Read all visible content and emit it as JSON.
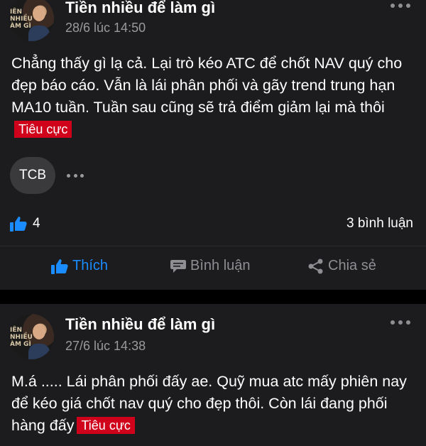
{
  "posts": [
    {
      "author": "Tiền nhiều để làm gì",
      "avatar_text": "IÊN\nNHIỀU\nÀM GÌ",
      "time": "28/6 lúc 14:50",
      "content": "Chẳng thấy gì lạ cả. Lại trò kéo ATC để chốt NAV quý cho đẹp báo cáo. Vẫn là lái phân phối và gãy trend trung hạn MA10 tuần. Tuần sau cũng sẽ trả điểm giảm lại mà thôi",
      "sentiment": "Tiêu cực",
      "ticker": "TCB",
      "likes": "4",
      "comments": "3 bình luận",
      "actions": {
        "like": "Thích",
        "comment": "Bình luận",
        "share": "Chia sẻ"
      }
    },
    {
      "author": "Tiền nhiều để làm gì",
      "avatar_text": "IÊN\nNHIỀU\nÀM GÌ",
      "time": "27/6 lúc 14:38",
      "content": "M.á ..... Lái phân phối đấy ae. Quỹ mua atc mấy phiên nay để kéo giá chốt nav quý cho đẹp thôi. Còn lái đang phối hàng đấy",
      "sentiment": "Tiêu cực"
    }
  ],
  "colors": {
    "card_bg": "#1c1c1e",
    "page_bg": "#000000",
    "accent_blue": "#1a8cff",
    "negative_tag": "#d0021b",
    "muted": "#8e8e93"
  },
  "icons": [
    "thumbs-up-icon",
    "comment-icon",
    "share-icon",
    "more-dots-icon"
  ]
}
